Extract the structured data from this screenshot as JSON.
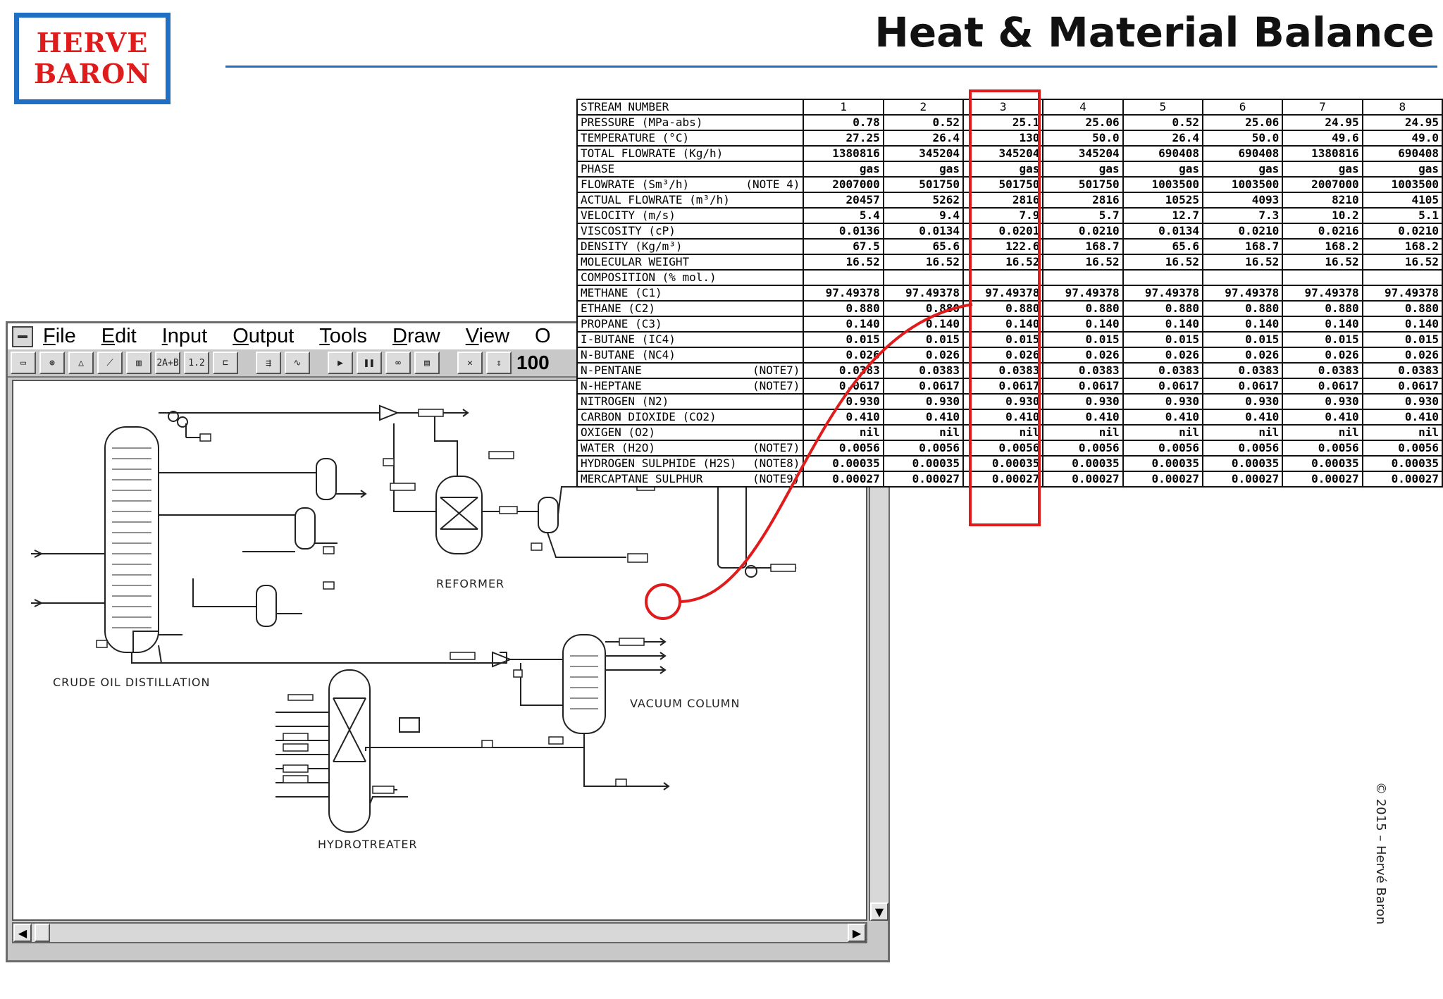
{
  "logo": {
    "line1": "HERVE",
    "line2": "BARON"
  },
  "title": "Heat & Material Balance",
  "copyright": "© 2015 – Hervé Baron",
  "app": {
    "menu": [
      {
        "u": "F",
        "rest": "ile"
      },
      {
        "u": "E",
        "rest": "dit"
      },
      {
        "u": "I",
        "rest": "nput"
      },
      {
        "u": "O",
        "rest": "utput"
      },
      {
        "u": "T",
        "rest": "ools"
      },
      {
        "u": "D",
        "rest": "raw"
      },
      {
        "u": "V",
        "rest": "iew"
      },
      {
        "u": "",
        "rest": "O"
      }
    ],
    "toolbar": {
      "zoom": "100",
      "btn_2ab": "2A+B",
      "btn_12": "1.2"
    },
    "labels": {
      "crude": "CRUDE  OIL DISTILLATION",
      "reformer": "REFORMER",
      "vacuum": "VACUUM COLUMN",
      "hydrotreater": "HYDROTREATER"
    }
  },
  "table": {
    "header": {
      "param": "STREAM NUMBER",
      "streams": [
        "1",
        "2",
        "3",
        "4",
        "5",
        "6",
        "7",
        "8"
      ]
    },
    "rows": [
      {
        "param": "PRESSURE (MPa-abs)",
        "note": "",
        "values": [
          "0.78",
          "0.52",
          "25.1",
          "25.06",
          "0.52",
          "25.06",
          "24.95",
          "24.95"
        ]
      },
      {
        "param": "TEMPERATURE (°C)",
        "note": "",
        "values": [
          "27.25",
          "26.4",
          "130",
          "50.0",
          "26.4",
          "50.0",
          "49.6",
          "49.0"
        ]
      },
      {
        "param": "TOTAL FLOWRATE (Kg/h)",
        "note": "",
        "values": [
          "1380816",
          "345204",
          "345204",
          "345204",
          "690408",
          "690408",
          "1380816",
          "690408"
        ]
      },
      {
        "param": "PHASE",
        "note": "",
        "values": [
          "gas",
          "gas",
          "gas",
          "gas",
          "gas",
          "gas",
          "gas",
          "gas"
        ]
      },
      {
        "param": "FLOWRATE (Sm³/h)",
        "note": "(NOTE 4)",
        "values": [
          "2007000",
          "501750",
          "501750",
          "501750",
          "1003500",
          "1003500",
          "2007000",
          "1003500"
        ]
      },
      {
        "param": "ACTUAL FLOWRATE (m³/h)",
        "note": "",
        "values": [
          "20457",
          "5262",
          "2816",
          "2816",
          "10525",
          "4093",
          "8210",
          "4105"
        ]
      },
      {
        "param": "VELOCITY (m/s)",
        "note": "",
        "values": [
          "5.4",
          "9.4",
          "7.9",
          "5.7",
          "12.7",
          "7.3",
          "10.2",
          "5.1"
        ]
      },
      {
        "param": "VISCOSITY (cP)",
        "note": "",
        "values": [
          "0.0136",
          "0.0134",
          "0.0201",
          "0.0210",
          "0.0134",
          "0.0210",
          "0.0216",
          "0.0210"
        ]
      },
      {
        "param": "DENSITY (Kg/m³)",
        "note": "",
        "values": [
          "67.5",
          "65.6",
          "122.6",
          "168.7",
          "65.6",
          "168.7",
          "168.2",
          "168.2"
        ]
      },
      {
        "param": "MOLECULAR WEIGHT",
        "note": "",
        "values": [
          "16.52",
          "16.52",
          "16.52",
          "16.52",
          "16.52",
          "16.52",
          "16.52",
          "16.52"
        ]
      },
      {
        "param": "COMPOSITION (% mol.)",
        "note": "",
        "values": [
          "",
          "",
          "",
          "",
          "",
          "",
          "",
          ""
        ]
      },
      {
        "param": "METHANE (C1)",
        "note": "",
        "values": [
          "97.49378",
          "97.49378",
          "97.49378",
          "97.49378",
          "97.49378",
          "97.49378",
          "97.49378",
          "97.49378"
        ]
      },
      {
        "param": "ETHANE (C2)",
        "note": "",
        "values": [
          "0.880",
          "0.880",
          "0.880",
          "0.880",
          "0.880",
          "0.880",
          "0.880",
          "0.880"
        ]
      },
      {
        "param": "PROPANE (C3)",
        "note": "",
        "values": [
          "0.140",
          "0.140",
          "0.140",
          "0.140",
          "0.140",
          "0.140",
          "0.140",
          "0.140"
        ]
      },
      {
        "param": "I-BUTANE (IC4)",
        "note": "",
        "values": [
          "0.015",
          "0.015",
          "0.015",
          "0.015",
          "0.015",
          "0.015",
          "0.015",
          "0.015"
        ]
      },
      {
        "param": "N-BUTANE (NC4)",
        "note": "",
        "values": [
          "0.026",
          "0.026",
          "0.026",
          "0.026",
          "0.026",
          "0.026",
          "0.026",
          "0.026"
        ]
      },
      {
        "param": "N-PENTANE",
        "note": "(NOTE7)",
        "values": [
          "0.0383",
          "0.0383",
          "0.0383",
          "0.0383",
          "0.0383",
          "0.0383",
          "0.0383",
          "0.0383"
        ]
      },
      {
        "param": "N-HEPTANE",
        "note": "(NOTE7)",
        "values": [
          "0.0617",
          "0.0617",
          "0.0617",
          "0.0617",
          "0.0617",
          "0.0617",
          "0.0617",
          "0.0617"
        ]
      },
      {
        "param": "NITROGEN (N2)",
        "note": "",
        "values": [
          "0.930",
          "0.930",
          "0.930",
          "0.930",
          "0.930",
          "0.930",
          "0.930",
          "0.930"
        ]
      },
      {
        "param": "CARBON DIOXIDE (CO2)",
        "note": "",
        "values": [
          "0.410",
          "0.410",
          "0.410",
          "0.410",
          "0.410",
          "0.410",
          "0.410",
          "0.410"
        ]
      },
      {
        "param": "OXIGEN (O2)",
        "note": "",
        "values": [
          "nil",
          "nil",
          "nil",
          "nil",
          "nil",
          "nil",
          "nil",
          "nil"
        ]
      },
      {
        "param": "WATER (H2O)",
        "note": "(NOTE7)",
        "values": [
          "0.0056",
          "0.0056",
          "0.0056",
          "0.0056",
          "0.0056",
          "0.0056",
          "0.0056",
          "0.0056"
        ]
      },
      {
        "param": "HYDROGEN SULPHIDE (H2S)",
        "note": "(NOTE8)",
        "values": [
          "0.00035",
          "0.00035",
          "0.00035",
          "0.00035",
          "0.00035",
          "0.00035",
          "0.00035",
          "0.00035"
        ]
      },
      {
        "param": "MERCAPTANE SULPHUR",
        "note": "(NOTE9)",
        "values": [
          "0.00027",
          "0.00027",
          "0.00027",
          "0.00027",
          "0.00027",
          "0.00027",
          "0.00027",
          "0.00027"
        ]
      }
    ]
  },
  "colors": {
    "accent": "#1f6fc4",
    "highlight": "#e01b1b"
  }
}
